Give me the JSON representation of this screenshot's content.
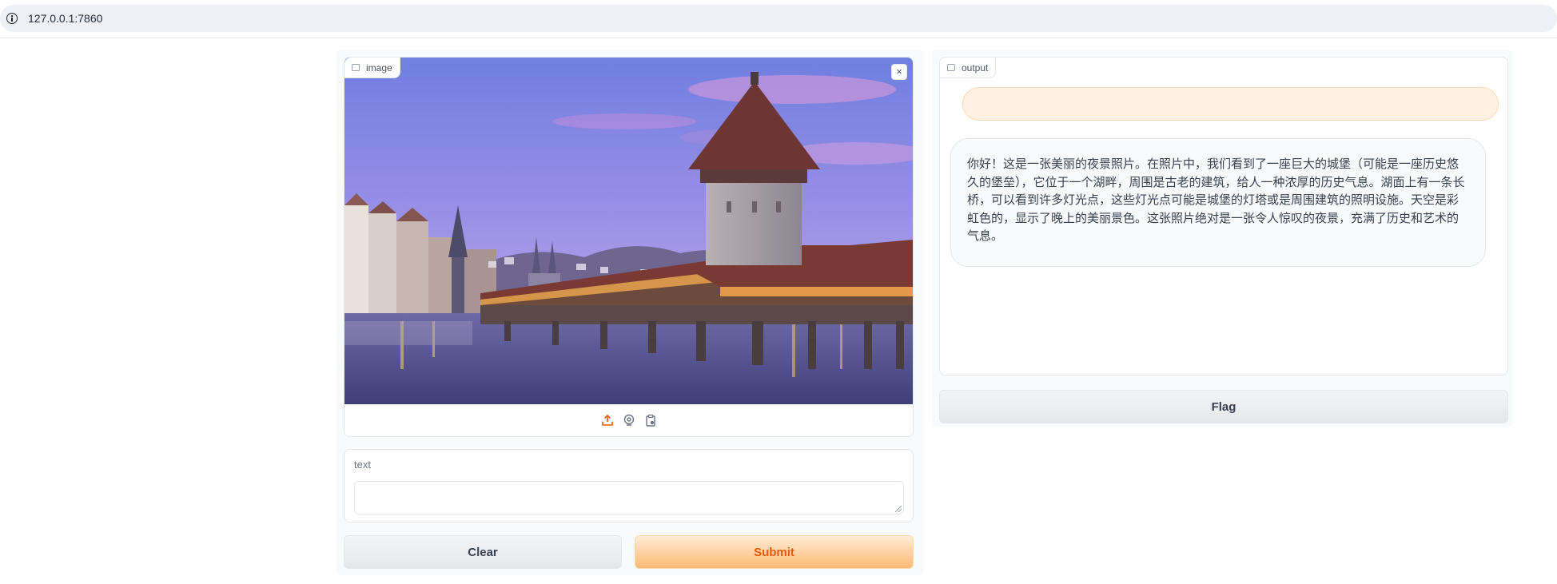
{
  "browser": {
    "url": "127.0.0.1:7860",
    "info_icon": "info-icon"
  },
  "image_input": {
    "label": "image",
    "icon": "image-icon",
    "close_icon": "close-icon",
    "close_symbol": "×",
    "sources": [
      "upload-icon",
      "webcam-icon",
      "clipboard-icon"
    ]
  },
  "text_input": {
    "label": "text",
    "value": "",
    "placeholder": ""
  },
  "buttons": {
    "clear": "Clear",
    "submit": "Submit",
    "flag": "Flag"
  },
  "output": {
    "label": "output",
    "icon": "chat-icon",
    "user_message": "",
    "bot_message": "你好！这是一张美丽的夜景照片。在照片中，我们看到了一座巨大的城堡（可能是一座历史悠久的堡垒），它位于一个湖畔，周围是古老的建筑，给人一种浓厚的历史气息。湖面上有一条长桥，可以看到许多灯光点，这些灯光点可能是城堡的灯塔或是周围建筑的照明设施。天空是彩虹色的，显示了晚上的美丽景色。这张照片绝对是一张令人惊叹的夜景，充满了历史和艺术的气息。"
  },
  "colors": {
    "accent": "#ea580c",
    "accent_bg": "#fdba74",
    "panel_bg": "#f9fafb",
    "border": "#e5e7eb"
  }
}
